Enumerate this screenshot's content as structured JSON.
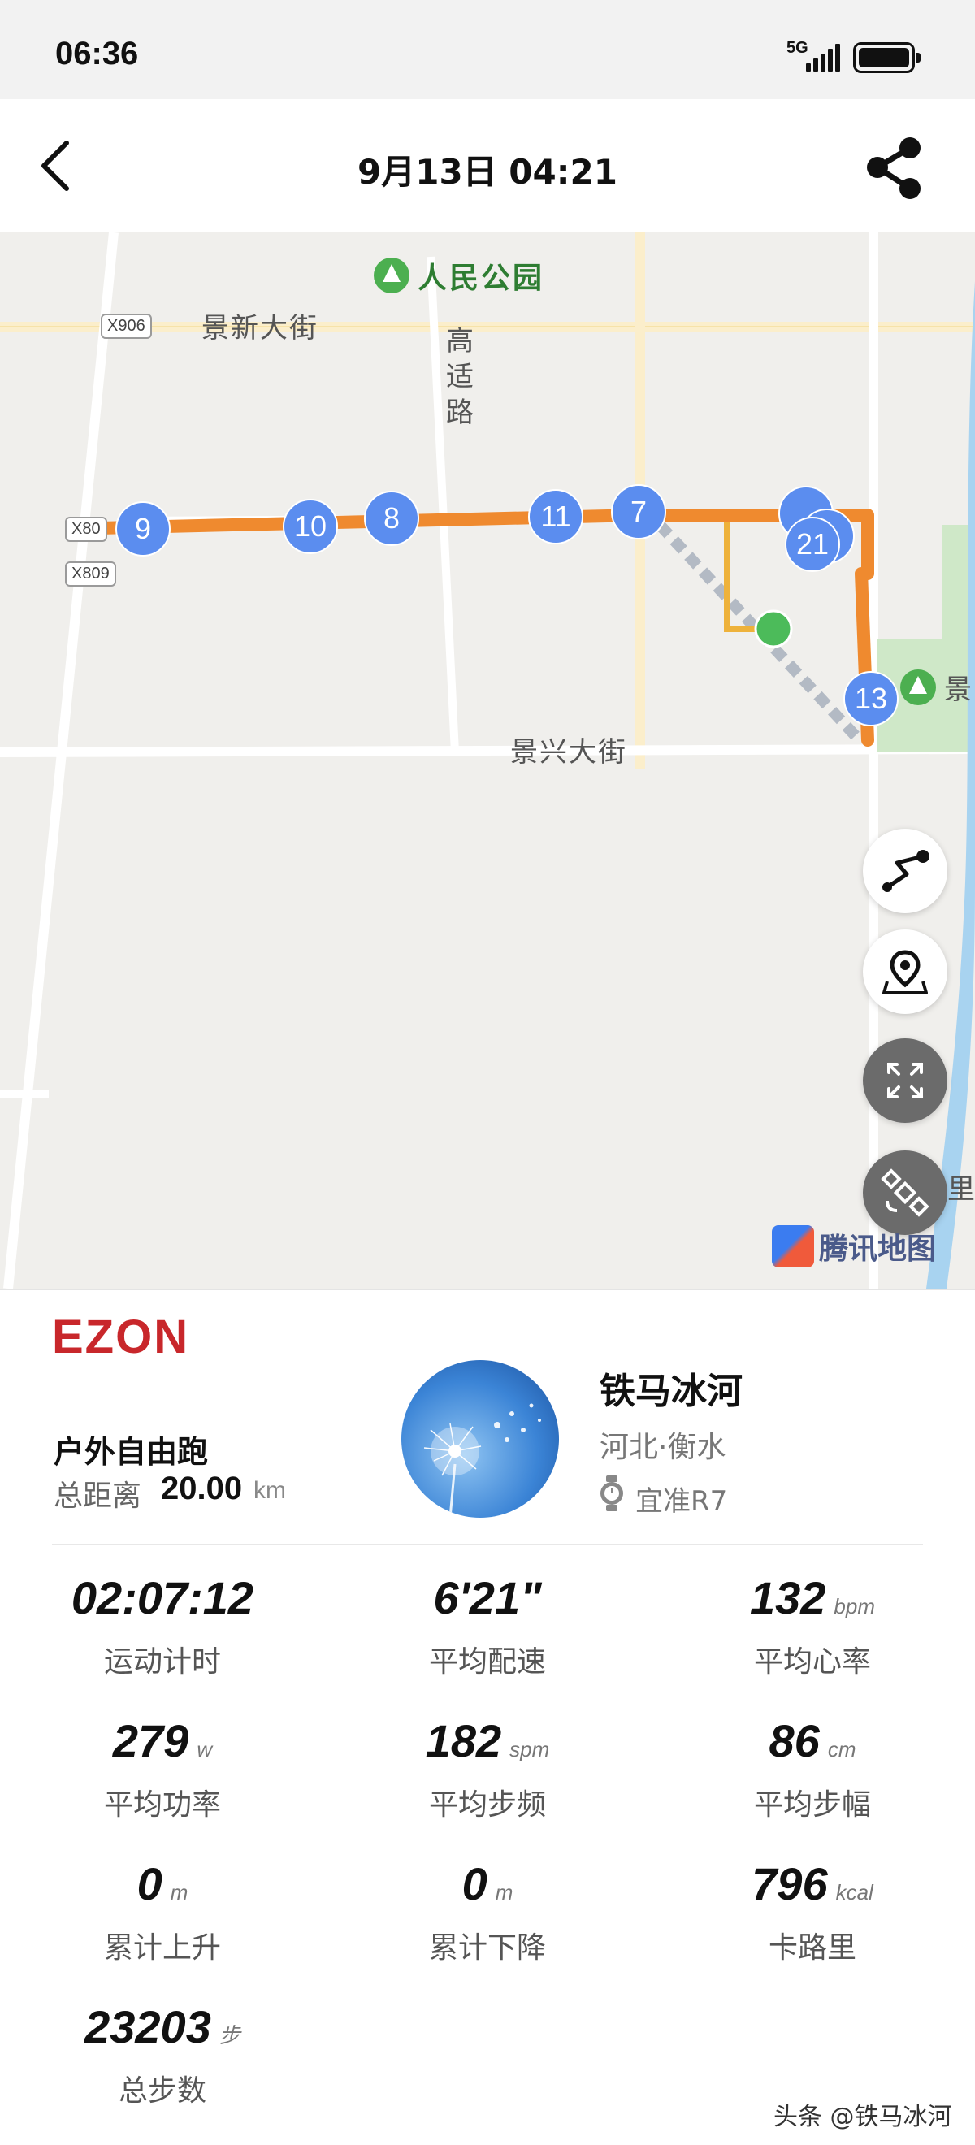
{
  "status_bar": {
    "time": "06:36",
    "network": "5G"
  },
  "header": {
    "title": "9月13日  04:21"
  },
  "map": {
    "labels": {
      "park_top": "人民公园",
      "road_jingxin": "景新大街",
      "road_gaoshi": "高适路",
      "road_jingxing": "景兴大街",
      "park_right": "景",
      "edge_text": "里亻",
      "road_tag_x906": "X906",
      "road_tag_x80": "X80",
      "road_tag_x809": "X809"
    },
    "markers": [
      "9",
      "10",
      "8",
      "11",
      "7",
      "21",
      "13"
    ],
    "attribution": "腾讯地图"
  },
  "colors": {
    "route": "#ef8a2f",
    "marker": "#5b8def",
    "brand": "#c8272b",
    "start_point": "#4cbb5a"
  },
  "summary": {
    "brand": "EZON",
    "sport_type": "户外自由跑",
    "distance_label": "总距离",
    "distance_value": "20.00",
    "distance_unit": "km",
    "user_name": "铁马冰河",
    "location": "河北·衡水",
    "device": "宜准R7"
  },
  "stats": [
    {
      "value": "02:07:12",
      "unit": "",
      "label": "运动计时"
    },
    {
      "value": "6'21\"",
      "unit": "",
      "label": "平均配速"
    },
    {
      "value": "132",
      "unit": "bpm",
      "label": "平均心率"
    },
    {
      "value": "279",
      "unit": "w",
      "label": "平均功率"
    },
    {
      "value": "182",
      "unit": "spm",
      "label": "平均步频"
    },
    {
      "value": "86",
      "unit": "cm",
      "label": "平均步幅"
    },
    {
      "value": "0",
      "unit": "m",
      "label": "累计上升"
    },
    {
      "value": "0",
      "unit": "m",
      "label": "累计下降"
    },
    {
      "value": "796",
      "unit": "kcal",
      "label": "卡路里"
    },
    {
      "value": "23203",
      "unit": "步",
      "label": "总步数"
    }
  ],
  "watermark": "头条 @铁马冰河"
}
